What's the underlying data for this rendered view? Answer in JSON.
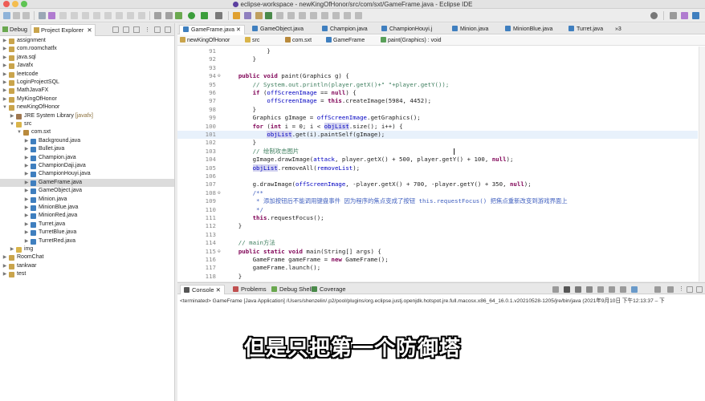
{
  "window": {
    "title": "eclipse-workspace - newKingOfHonor/src/com/sxt/GameFrame.java - Eclipse IDE"
  },
  "left_panel": {
    "tabs": [
      {
        "label": "Debug"
      },
      {
        "label": "Project Explorer"
      }
    ],
    "tree": [
      {
        "label": "assignment",
        "depth": 0,
        "expanded": false,
        "type": "project"
      },
      {
        "label": "com.roomchatfx",
        "depth": 0,
        "expanded": false,
        "type": "project"
      },
      {
        "label": "java.sql",
        "depth": 0,
        "expanded": false,
        "type": "project"
      },
      {
        "label": "Javafx",
        "depth": 0,
        "expanded": false,
        "type": "project"
      },
      {
        "label": "leetcode",
        "depth": 0,
        "expanded": false,
        "type": "project"
      },
      {
        "label": "LoginProjectSQL",
        "depth": 0,
        "expanded": false,
        "type": "project"
      },
      {
        "label": "MathJavaFX",
        "depth": 0,
        "expanded": false,
        "type": "project"
      },
      {
        "label": "MyKingOfHonor",
        "depth": 0,
        "expanded": false,
        "type": "project"
      },
      {
        "label": "newKingOfHonor",
        "depth": 0,
        "expanded": true,
        "type": "project"
      },
      {
        "label": "JRE System Library",
        "decoration": "[javafx]",
        "depth": 1,
        "expanded": false,
        "type": "library"
      },
      {
        "label": "src",
        "depth": 1,
        "expanded": true,
        "type": "folder"
      },
      {
        "label": "com.sxt",
        "depth": 2,
        "expanded": true,
        "type": "package"
      },
      {
        "label": "Background.java",
        "depth": 3,
        "expanded": false,
        "type": "java"
      },
      {
        "label": "Bullet.java",
        "depth": 3,
        "expanded": false,
        "type": "java"
      },
      {
        "label": "Champion.java",
        "depth": 3,
        "expanded": false,
        "type": "java"
      },
      {
        "label": "ChampionDaji.java",
        "depth": 3,
        "expanded": false,
        "type": "java"
      },
      {
        "label": "ChampionHouyi.java",
        "depth": 3,
        "expanded": false,
        "type": "java"
      },
      {
        "label": "GameFrame.java",
        "depth": 3,
        "expanded": false,
        "type": "java",
        "selected": true
      },
      {
        "label": "GameObject.java",
        "depth": 3,
        "expanded": false,
        "type": "java"
      },
      {
        "label": "Minion.java",
        "depth": 3,
        "expanded": false,
        "type": "java"
      },
      {
        "label": "MinionBlue.java",
        "depth": 3,
        "expanded": false,
        "type": "java"
      },
      {
        "label": "MinionRed.java",
        "depth": 3,
        "expanded": false,
        "type": "java"
      },
      {
        "label": "Turret.java",
        "depth": 3,
        "expanded": false,
        "type": "java"
      },
      {
        "label": "TurretBlue.java",
        "depth": 3,
        "expanded": false,
        "type": "java"
      },
      {
        "label": "TurretRed.java",
        "depth": 3,
        "expanded": false,
        "type": "java"
      },
      {
        "label": "img",
        "depth": 1,
        "expanded": false,
        "type": "folder"
      },
      {
        "label": "RoomChat",
        "depth": 0,
        "expanded": false,
        "type": "project"
      },
      {
        "label": "tankwar",
        "depth": 0,
        "expanded": false,
        "type": "project"
      },
      {
        "label": "test",
        "depth": 0,
        "expanded": false,
        "type": "project"
      }
    ]
  },
  "editor": {
    "tabs": [
      {
        "label": "GameFrame.java",
        "active": true
      },
      {
        "label": "GameObject.java"
      },
      {
        "label": "Champion.java"
      },
      {
        "label": "ChampionHouyi.j"
      },
      {
        "label": "Minion.java"
      },
      {
        "label": "MinionBlue.java"
      },
      {
        "label": "Turret.java"
      },
      {
        "label": "»3"
      }
    ],
    "breadcrumbs": [
      "newKingOfHonor",
      "src",
      "com.sxt",
      "GameFrame",
      "paint(Graphics) : void"
    ],
    "lines": [
      {
        "n": "91",
        "text": "            }"
      },
      {
        "n": "92",
        "text": "        }"
      },
      {
        "n": "93",
        "text": ""
      },
      {
        "n": "94",
        "text": "    public void paint(Graphics g) {",
        "fold": true
      },
      {
        "n": "95",
        "text": "        // System.out.println(player.getX()+\" \"+player.getY());"
      },
      {
        "n": "96",
        "text": "        if (offScreenImage == null) {"
      },
      {
        "n": "97",
        "text": "            offScreenImage = this.createImage(5984, 4452);"
      },
      {
        "n": "98",
        "text": "        }"
      },
      {
        "n": "99",
        "text": "        Graphics gImage = offScreenImage.getGraphics();"
      },
      {
        "n": "100",
        "text": "        for (int i = 0; i < objList.size(); i++) {"
      },
      {
        "n": "101",
        "text": "            objList.get(i).paintSelf(gImage);",
        "highlight": true
      },
      {
        "n": "102",
        "text": "        }"
      },
      {
        "n": "103",
        "text": "        // 绘制攻击图片"
      },
      {
        "n": "104",
        "text": "        gImage.drawImage(attack, player.getX() + 500, player.getY() + 100, null);"
      },
      {
        "n": "105",
        "text": "        objList.removeAll(removeList);"
      },
      {
        "n": "106",
        "text": ""
      },
      {
        "n": "107",
        "text": "        g.drawImage(offScreenImage, -player.getX() + 700, -player.getY() + 350, null);"
      },
      {
        "n": "108",
        "text": "        /**",
        "fold": true
      },
      {
        "n": "109",
        "text": "         * 添加按钮后不能调用键盘事件 因为程序的焦点变成了按钮 this.requestFocus() 把焦点重新改变到游戏界面上"
      },
      {
        "n": "110",
        "text": "         */"
      },
      {
        "n": "111",
        "text": "        this.requestFocus();"
      },
      {
        "n": "112",
        "text": "    }"
      },
      {
        "n": "113",
        "text": ""
      },
      {
        "n": "114",
        "text": "    // main方法"
      },
      {
        "n": "115",
        "text": "    public static void main(String[] args) {",
        "fold": true
      },
      {
        "n": "116",
        "text": "        GameFrame gameFrame = new GameFrame();"
      },
      {
        "n": "117",
        "text": "        gameFrame.launch();"
      },
      {
        "n": "118",
        "text": "    }"
      }
    ]
  },
  "console": {
    "tabs": [
      {
        "label": "Console",
        "active": true
      },
      {
        "label": "Problems"
      },
      {
        "label": "Debug Shell"
      },
      {
        "label": "Coverage"
      }
    ],
    "terminated": "<terminated> GameFrame [Java Application] /Users/shenzelin/.p2/pool/plugins/org.eclipse.justj.openjdk.hotspot.jre.full.macosx.x86_64_16.0.1.v20210528-1205/jre/bin/java  (2021年9月10日 下午12:13:37 – 下"
  },
  "subtitle": "但是只把第一个防御塔"
}
